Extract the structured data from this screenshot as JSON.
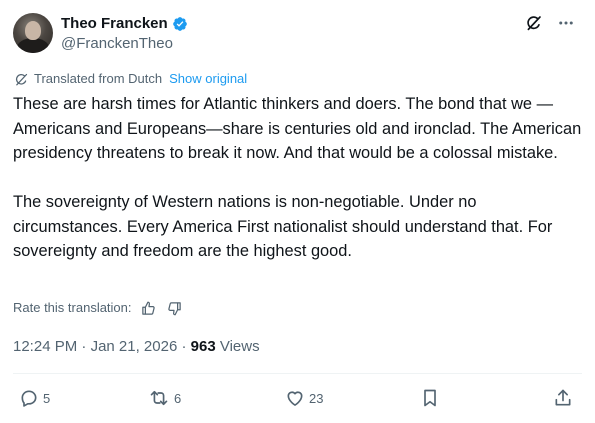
{
  "author": {
    "display_name": "Theo Francken",
    "handle": "@FranckenTheo",
    "verified": true
  },
  "translation": {
    "label": "Translated from Dutch",
    "show_original": "Show original"
  },
  "tweet": {
    "paragraphs": [
      "These are harsh times for Atlantic thinkers and doers. The bond that we —Americans and Europeans—share is centuries old and ironclad. The American presidency threatens to break it now. And that would be a colossal mistake.",
      "The sovereignty of Western nations is non-negotiable. Under no circumstances. Every America First nationalist should understand that. For sovereignty and freedom are the highest good."
    ]
  },
  "rating": {
    "label": "Rate this translation:"
  },
  "meta": {
    "time": "12:24 PM",
    "separator": "·",
    "date": "Jan 21, 2026",
    "views_count": "963",
    "views_label": "Views"
  },
  "actions": {
    "replies": "5",
    "reposts": "6",
    "likes": "23"
  },
  "colors": {
    "accent": "#1d9bf0",
    "text_primary": "#0f1419",
    "text_secondary": "#536471",
    "divider": "#eff3f4"
  },
  "icons": {
    "verified": "verified-badge-icon",
    "grok": "grok-icon",
    "more": "more-icon",
    "translate": "translate-icon",
    "thumbs_up": "thumbs-up-icon",
    "thumbs_down": "thumbs-down-icon",
    "reply": "reply-icon",
    "repost": "repost-icon",
    "like": "like-icon",
    "bookmark": "bookmark-icon",
    "share": "share-icon"
  }
}
